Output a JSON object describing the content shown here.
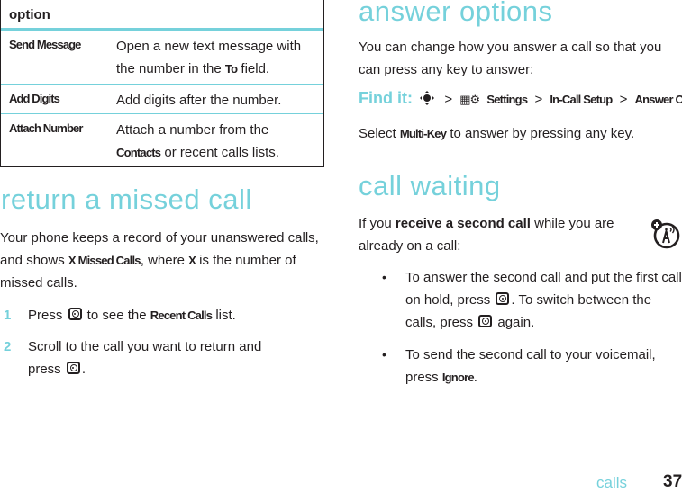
{
  "options_table": {
    "header": "option",
    "rows": [
      {
        "name": "Send Message",
        "desc_before": "Open a new text message with the number in the ",
        "desc_bold": "To",
        "desc_after": " field."
      },
      {
        "name": "Add Digits",
        "desc_before": "Add digits after the number.",
        "desc_bold": "",
        "desc_after": ""
      },
      {
        "name": "Attach Number",
        "desc_before": "Attach a number from the ",
        "desc_bold": "Contacts",
        "desc_after": " or recent calls lists."
      }
    ]
  },
  "missed_call": {
    "heading": "return a missed call",
    "intro": {
      "part1": "Your phone keeps a record of your unanswered calls, and shows ",
      "bold1": "X Missed Calls",
      "part2": ", where ",
      "bold2": "X",
      "part3": " is the number of missed calls."
    },
    "steps": [
      {
        "num": "1",
        "before": "Press ",
        "after_key": " to see the ",
        "bold": "Recent Calls",
        "end": " list."
      },
      {
        "num": "2",
        "before": "Scroll to the call you want to return and press ",
        "end": "."
      }
    ]
  },
  "answer_options": {
    "heading": "answer options",
    "intro": "You can change how you answer a call so that you can press any key to answer:",
    "find_it": {
      "label": "Find it:",
      "nav_icon": "nav-key-icon",
      "separator": ">",
      "settings_icon": "settings-icon",
      "path": [
        "Settings",
        "In-Call Setup",
        "Answer Options"
      ]
    },
    "select": {
      "before": "Select ",
      "bold": "Multi-Key",
      "after": " to answer by pressing any key."
    }
  },
  "call_waiting": {
    "heading": "call waiting",
    "intro": {
      "before": "If you ",
      "bold": "receive a second call",
      "after": " while you are already on a call:"
    },
    "feature_icon": "network-feature-icon",
    "bullets": [
      {
        "part1": "To answer the second call and put the first call on hold, press ",
        "part2": ". To switch between the calls, press ",
        "part3": " again."
      },
      {
        "before": "To send the second call to your voicemail, press ",
        "bold": "Ignore",
        "after": "."
      }
    ],
    "bullet_glyph": "•"
  },
  "footer": {
    "section": "calls",
    "page_number": "37"
  },
  "colors": {
    "accent": "#75d1db",
    "text": "#231f20"
  }
}
